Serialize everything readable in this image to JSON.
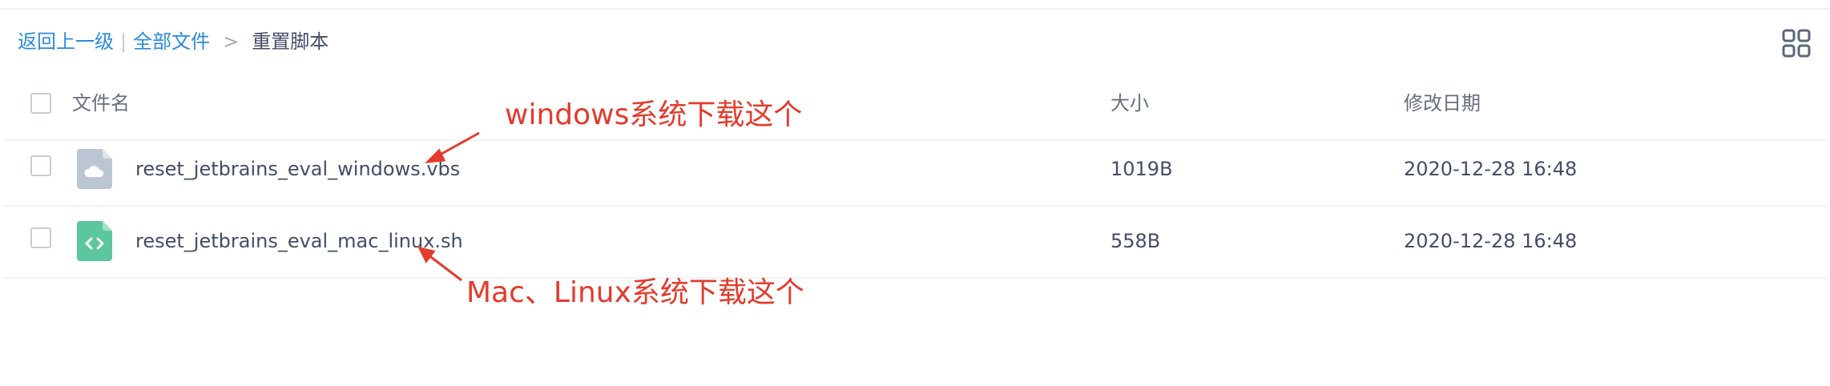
{
  "breadcrumb": {
    "back": "返回上一级",
    "separator_bar": "|",
    "all_files": "全部文件",
    "separator_arrow": ">",
    "current": "重置脚本"
  },
  "view_toggle": {
    "icon": "grid-view-icon"
  },
  "table": {
    "headers": {
      "name": "文件名",
      "size": "大小",
      "modified": "修改日期"
    },
    "rows": [
      {
        "name": "reset_jetbrains_eval_windows.vbs",
        "size": "1019B",
        "modified": "2020-12-28 16:48",
        "icon": "cloud-file-icon"
      },
      {
        "name": "reset_jetbrains_eval_mac_linux.sh",
        "size": "558B",
        "modified": "2020-12-28 16:48",
        "icon": "code-file-icon"
      }
    ]
  },
  "annotations": {
    "windows": "windows系统下载这个",
    "mac_linux": "Mac、Linux系统下载这个"
  },
  "colors": {
    "link": "#2a8bdb",
    "annotation": "#e33b2c",
    "text": "#424e67",
    "header_text": "#666f80",
    "cloud_icon_bg": "#bcc6d3",
    "code_icon_bg": "#5cc79f"
  }
}
